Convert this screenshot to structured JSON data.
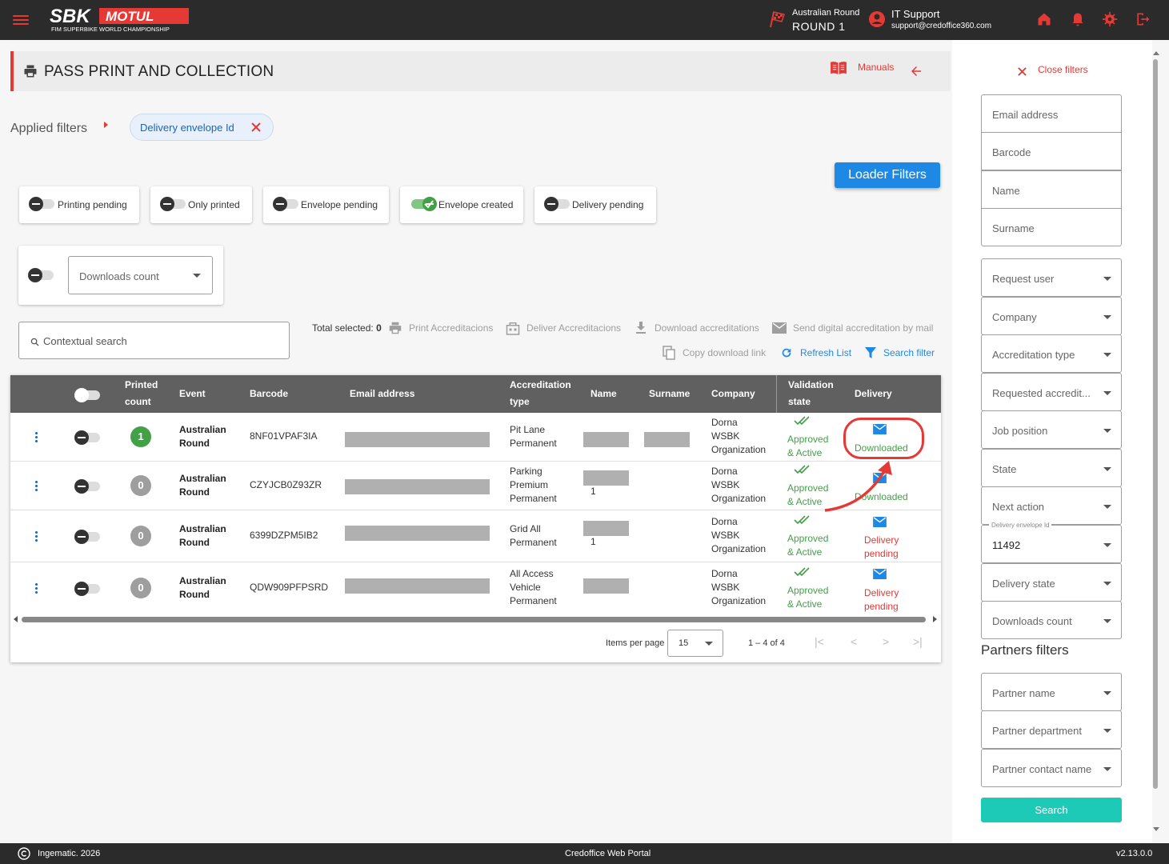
{
  "header": {
    "round_label": "Australian Round",
    "round_name": "ROUND 1",
    "user_name": "IT Support",
    "user_email": "support@credoffice360.com"
  },
  "page": {
    "title": "PASS PRINT AND COLLECTION",
    "manuals": "Manuals",
    "applied_filters": "Applied filters",
    "chip": "Delivery envelope Id",
    "loader_filters": "Loader Filters"
  },
  "toggles": [
    {
      "label": "Printing pending",
      "on": false
    },
    {
      "label": "Only printed",
      "on": false
    },
    {
      "label": "Envelope pending",
      "on": false
    },
    {
      "label": "Envelope created",
      "on": true
    },
    {
      "label": "Delivery pending",
      "on": false
    }
  ],
  "downloads_select": "Downloads count",
  "contextual_search": "Contextual search",
  "actions": {
    "total_selected_label": "Total selected:",
    "total_selected_value": "0",
    "print": "Print Accreditacions",
    "deliver": "Deliver Accreditacions",
    "download": "Download accreditations",
    "send_mail": "Send digital accreditation by mail",
    "copy_link": "Copy download link",
    "refresh": "Refresh List",
    "search_filter": "Search filter"
  },
  "table": {
    "headers": {
      "printed": "Printed",
      "count": "count",
      "event": "Event",
      "barcode": "Barcode",
      "email": "Email address",
      "acc1": "Accreditation",
      "acc2": "type",
      "name": "Name",
      "surname": "Surname",
      "company": "Company",
      "val1": "Validation",
      "val2": "state",
      "delivery": "Delivery"
    },
    "rows": [
      {
        "count": "1",
        "ev1": "Australian",
        "ev2": "Round",
        "barcode": "8NF01VPAF3IA",
        "acc1": "Pit Lane",
        "acc2": "Permanent",
        "acc3": "",
        "name_extra": "",
        "co1": "Dorna",
        "co2": "WSBK",
        "co3": "Organization",
        "val1": "Approved",
        "val2": "& Active",
        "del1": "Downloaded",
        "del2": ""
      },
      {
        "count": "0",
        "ev1": "Australian",
        "ev2": "Round",
        "barcode": "CZYJCB0Z93ZR",
        "acc1": "Parking",
        "acc2": "Premium",
        "acc3": "Permanent",
        "name_extra": "1",
        "co1": "Dorna",
        "co2": "WSBK",
        "co3": "Organization",
        "val1": "Approved",
        "val2": "& Active",
        "del1": "Downloaded",
        "del2": ""
      },
      {
        "count": "0",
        "ev1": "Australian",
        "ev2": "Round",
        "barcode": "6399DZPM5IB2",
        "acc1": "Grid All",
        "acc2": "Permanent",
        "acc3": "",
        "name_extra": "1",
        "co1": "Dorna",
        "co2": "WSBK",
        "co3": "Organization",
        "val1": "Approved",
        "val2": "& Active",
        "del1": "Delivery",
        "del2": "pending"
      },
      {
        "count": "0",
        "ev1": "Australian",
        "ev2": "Round",
        "barcode": "QDW909PFPSRD",
        "acc1": "All Access",
        "acc2": "Vehicle",
        "acc3": "Permanent",
        "name_extra": "",
        "co1": "Dorna",
        "co2": "WSBK",
        "co3": "Organization",
        "val1": "Approved",
        "val2": "& Active",
        "del1": "Delivery",
        "del2": "pending"
      }
    ],
    "items_per_page_label": "Items per page",
    "items_per_page": "15",
    "range": "1 – 4 of 4"
  },
  "sidebar": {
    "close_filters": "Close filters",
    "fields": [
      "Email address",
      "Barcode",
      "Name",
      "Surname"
    ],
    "selects": [
      "Request user",
      "Company",
      "Accreditation type",
      "Requested accredit...",
      "Job position",
      "State",
      "Next action"
    ],
    "envelope_label": "Delivery envelope Id",
    "envelope_value": "11492",
    "selects2": [
      "Delivery state",
      "Downloads count"
    ],
    "partners_title": "Partners filters",
    "partner_selects": [
      "Partner name",
      "Partner department",
      "Partner contact name"
    ],
    "search_button": "Search"
  },
  "footer": {
    "copyright": "Ingematic. 2026",
    "portal": "Credoffice Web Portal",
    "version": "v2.13.0.0"
  },
  "colors": {
    "accent": "#e53935",
    "primary": "#1e88e5",
    "success": "#43a047",
    "teal": "#1dc9b7"
  }
}
